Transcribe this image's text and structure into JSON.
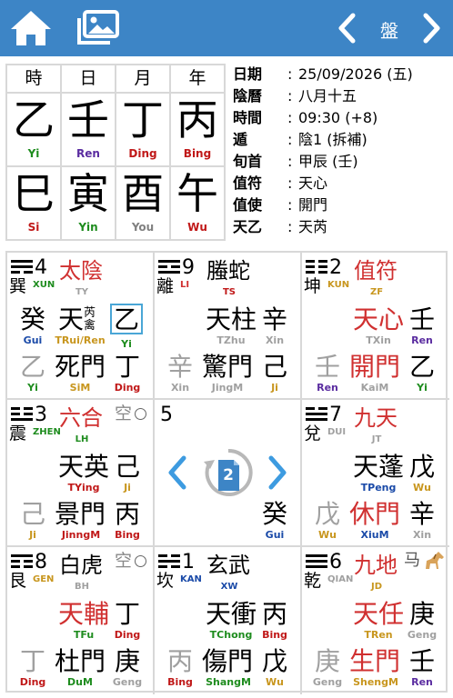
{
  "header": {
    "title": "盤",
    "home_icon": "home-icon",
    "image_icon": "image-gallery-icon",
    "prev_icon": "chevron-left-icon",
    "next_icon": "chevron-right-icon"
  },
  "pillars": {
    "headers": [
      "時",
      "日",
      "月",
      "年"
    ],
    "stems": [
      {
        "char": "乙",
        "py": "Yi"
      },
      {
        "char": "壬",
        "py": "Ren"
      },
      {
        "char": "丁",
        "py": "Ding"
      },
      {
        "char": "丙",
        "py": "Bing"
      }
    ],
    "branches": [
      {
        "char": "巳",
        "py": "Si"
      },
      {
        "char": "寅",
        "py": "Yin"
      },
      {
        "char": "酉",
        "py": "You"
      },
      {
        "char": "午",
        "py": "Wu"
      }
    ]
  },
  "info": [
    {
      "k": "日期",
      "v": "25/09/2026 (五)"
    },
    {
      "k": "陰曆",
      "v": "八月十五"
    },
    {
      "k": "時間",
      "v": "09:30 (+8)"
    },
    {
      "k": "遁",
      "v": "陰1 (拆補)"
    },
    {
      "k": "旬首",
      "v": "甲辰 (壬)"
    },
    {
      "k": "值符",
      "v": "天心"
    },
    {
      "k": "值使",
      "v": "開門"
    },
    {
      "k": "天乙",
      "v": "天芮"
    }
  ],
  "palaces": [
    {
      "num": "4",
      "gua": "巽",
      "gua_py": "XUN",
      "god": "太陰",
      "god_py": "TY",
      "a": "癸",
      "a_py": "Gui",
      "star": "天",
      "star2": "芮禽",
      "star_py": "TRui/Ren",
      "c": "乙",
      "c_py": "Yi",
      "d": "乙",
      "d_py": "Yi",
      "door": "死門",
      "door_py": "SiM",
      "e": "丁",
      "e_py": "Ding"
    },
    {
      "num": "9",
      "gua": "離",
      "gua_py": "LI",
      "god": "螣蛇",
      "god_py": "TS",
      "star": "天柱",
      "star_py": "TZhu",
      "c": "辛",
      "c_py": "Xin",
      "d": "辛",
      "d_py": "Xin",
      "door": "驚門",
      "door_py": "JingM",
      "e": "己",
      "e_py": "Ji"
    },
    {
      "num": "2",
      "gua": "坤",
      "gua_py": "KUN",
      "god": "值符",
      "god_py": "ZF",
      "star": "天心",
      "star_py": "TXin",
      "c": "壬",
      "c_py": "Ren",
      "d": "壬",
      "d_py": "Ren",
      "door": "開門",
      "door_py": "KaiM",
      "e": "乙",
      "e_py": "Yi"
    },
    {
      "num": "3",
      "gua": "震",
      "gua_py": "ZHEN",
      "god": "六合",
      "god_py": "LH",
      "kong": "空",
      "star": "天英",
      "star_py": "TYing",
      "c": "己",
      "c_py": "Ji",
      "d": "己",
      "d_py": "Ji",
      "door": "景門",
      "door_py": "JinngM",
      "e": "丙",
      "e_py": "Bing"
    },
    {
      "num": "5",
      "e": "癸",
      "e_py": "Gui",
      "badge": "2",
      "swap_icon": "rotate-page-icon"
    },
    {
      "num": "7",
      "gua": "兌",
      "gua_py": "DUI",
      "god": "九天",
      "god_py": "JT",
      "star": "天蓬",
      "star_py": "TPeng",
      "c": "戊",
      "c_py": "Wu",
      "d": "戊",
      "d_py": "Wu",
      "door": "休門",
      "door_py": "XiuM",
      "e": "辛",
      "e_py": "Xin"
    },
    {
      "num": "8",
      "gua": "艮",
      "gua_py": "GEN",
      "god": "白虎",
      "god_py": "BH",
      "kong": "空",
      "star": "天輔",
      "star_py": "TFu",
      "c": "丁",
      "c_py": "Ding",
      "d": "丁",
      "d_py": "Ding",
      "door": "杜門",
      "door_py": "DuM",
      "e": "庚",
      "e_py": "Geng"
    },
    {
      "num": "1",
      "gua": "坎",
      "gua_py": "KAN",
      "god": "玄武",
      "god_py": "XW",
      "star": "天衝",
      "star_py": "TChong",
      "c": "丙",
      "c_py": "Bing",
      "d": "丙",
      "d_py": "Bing",
      "door": "傷門",
      "door_py": "ShangM",
      "e": "戊",
      "e_py": "Wu"
    },
    {
      "num": "6",
      "gua": "乾",
      "gua_py": "QIAN",
      "god": "九地",
      "god_py": "JD",
      "horse": "马",
      "horse_icon": "horse-icon",
      "star": "天任",
      "star_py": "TRen",
      "c": "庚",
      "c_py": "Geng",
      "d": "庚",
      "d_py": "Geng",
      "door": "生門",
      "door_py": "ShengM",
      "e": "壬",
      "e_py": "Ren"
    }
  ]
}
